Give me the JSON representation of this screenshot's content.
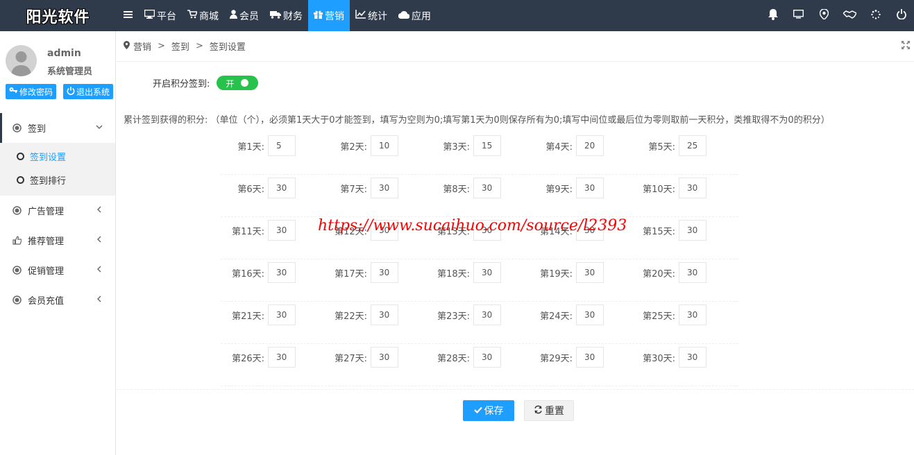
{
  "app": {
    "title": "阳光软件"
  },
  "nav": {
    "items": [
      {
        "label": "平台",
        "icon": "monitor-icon"
      },
      {
        "label": "商城",
        "icon": "cart-icon"
      },
      {
        "label": "会员",
        "icon": "user-icon"
      },
      {
        "label": "财务",
        "icon": "truck-icon"
      },
      {
        "label": "营销",
        "icon": "gift-icon",
        "active": true
      },
      {
        "label": "统计",
        "icon": "line-chart-icon"
      },
      {
        "label": "应用",
        "icon": "cloud-icon"
      }
    ],
    "right_icons": [
      "bell-icon",
      "screen-icon",
      "location-icon",
      "handshake-icon",
      "spinner-icon",
      "power-icon"
    ]
  },
  "user": {
    "name": "admin",
    "role": "系统管理员",
    "change_password": "修改密码",
    "logout": "退出系统"
  },
  "sidebar": {
    "groups": [
      {
        "label": "签到",
        "icon": "dot-circle-icon",
        "open": true,
        "items": [
          {
            "label": "签到设置",
            "active": true
          },
          {
            "label": "签到排行"
          }
        ]
      },
      {
        "label": "广告管理",
        "icon": "dot-circle-icon"
      },
      {
        "label": "推荐管理",
        "icon": "thumbs-up-icon"
      },
      {
        "label": "促销管理",
        "icon": "dot-circle-icon"
      },
      {
        "label": "会员充值",
        "icon": "dot-circle-icon"
      }
    ]
  },
  "breadcrumb": [
    "营销",
    "签到",
    "签到设置"
  ],
  "form": {
    "switch_label": "开启积分签到:",
    "switch_text": "开",
    "switch_on": true,
    "points_label": "累计签到获得的积分:",
    "points_desc": "（单位（个），必须第1天大于0才能签到，填写为空则为0;填写第1天为0则保存所有为0;填写中间位或最后位为零则取前一天积分，类推取得不为0的积分）",
    "days": [
      {
        "label": "第1天:",
        "value": "5"
      },
      {
        "label": "第2天:",
        "value": "10"
      },
      {
        "label": "第3天:",
        "value": "15"
      },
      {
        "label": "第4天:",
        "value": "20"
      },
      {
        "label": "第5天:",
        "value": "25"
      },
      {
        "label": "第6天:",
        "value": "30"
      },
      {
        "label": "第7天:",
        "value": "30"
      },
      {
        "label": "第8天:",
        "value": "30"
      },
      {
        "label": "第9天:",
        "value": "30"
      },
      {
        "label": "第10天:",
        "value": "30"
      },
      {
        "label": "第11天:",
        "value": "30"
      },
      {
        "label": "第12天:",
        "value": "30"
      },
      {
        "label": "第13天:",
        "value": "30"
      },
      {
        "label": "第14天:",
        "value": "30"
      },
      {
        "label": "第15天:",
        "value": "30"
      },
      {
        "label": "第16天:",
        "value": "30"
      },
      {
        "label": "第17天:",
        "value": "30"
      },
      {
        "label": "第18天:",
        "value": "30"
      },
      {
        "label": "第19天:",
        "value": "30"
      },
      {
        "label": "第20天:",
        "value": "30"
      },
      {
        "label": "第21天:",
        "value": "30"
      },
      {
        "label": "第22天:",
        "value": "30"
      },
      {
        "label": "第23天:",
        "value": "30"
      },
      {
        "label": "第24天:",
        "value": "30"
      },
      {
        "label": "第25天:",
        "value": "30"
      },
      {
        "label": "第26天:",
        "value": "30"
      },
      {
        "label": "第27天:",
        "value": "30"
      },
      {
        "label": "第28天:",
        "value": "30"
      },
      {
        "label": "第29天:",
        "value": "30"
      },
      {
        "label": "第30天:",
        "value": "30"
      }
    ],
    "save_label": "保存",
    "reset_label": "重置"
  },
  "watermark": "https://www.sucaihuo.com/source/l2393",
  "colors": {
    "topbar": "#2f3a4b",
    "accent": "#1e9fff",
    "switch_on": "#27c24c",
    "watermark": "#ff0000"
  }
}
